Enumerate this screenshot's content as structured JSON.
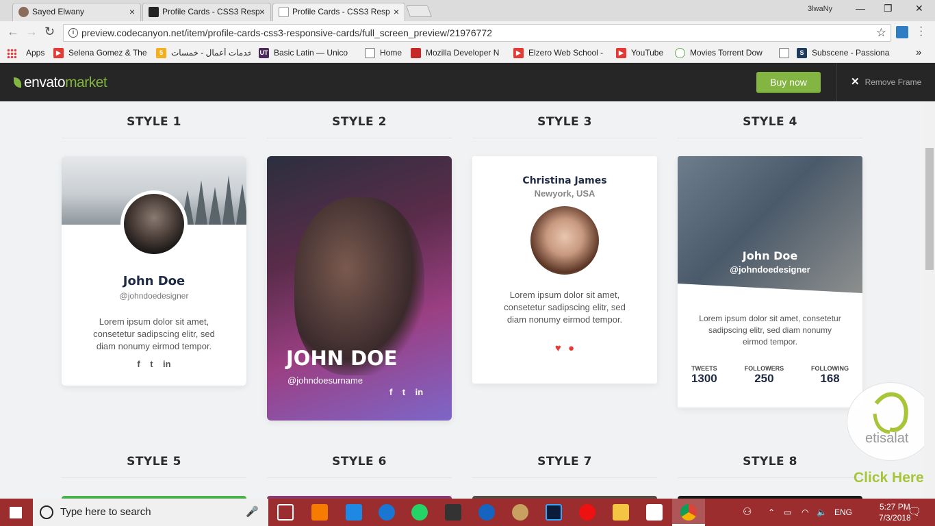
{
  "browser": {
    "tabs": [
      {
        "title": "Sayed Elwany",
        "close": "×"
      },
      {
        "title": "Profile Cards - CSS3 Resp",
        "close": "×"
      },
      {
        "title": "Profile Cards - CSS3 Resp",
        "close": "×"
      }
    ],
    "profile": "3lwaNy",
    "window_controls": {
      "minimize": "—",
      "restore": "❐",
      "close": "✕"
    },
    "url": "preview.codecanyon.net/item/profile-cards-css3-responsive-cards/full_screen_preview/21976772",
    "bookmarks": [
      {
        "label": "Apps"
      },
      {
        "label": "Selena Gomez & The",
        "color": "#e53935"
      },
      {
        "label": "خدمات أعمال - خمسات",
        "icon_text": "5",
        "color": "#f2b01e"
      },
      {
        "label": "Basic Latin — Unico",
        "icon_text": "UT",
        "color": "#4a2a5c"
      },
      {
        "label": "Home",
        "color": "#ffffff"
      },
      {
        "label": "Mozilla Developer N",
        "color": "#c62828"
      },
      {
        "label": "Elzero Web School -",
        "color": "#e53935"
      },
      {
        "label": "YouTube",
        "color": "#e53935"
      },
      {
        "label": "Movies Torrent Dow",
        "color": "#6aa84f"
      },
      {
        "label": "",
        "color": "#ffffff"
      },
      {
        "label": "Subscene - Passiona",
        "icon_text": "S",
        "color": "#1f3a5c"
      }
    ],
    "more_bookmarks": "»"
  },
  "envato": {
    "logo_envato": "envato",
    "logo_market": "market",
    "buy_now": "Buy now",
    "remove_frame": "Remove Frame",
    "remove_icon": "✕"
  },
  "styles": {
    "s1": "STYLE 1",
    "s2": "STYLE 2",
    "s3": "STYLE 3",
    "s4": "STYLE 4",
    "s5": "STYLE 5",
    "s6": "STYLE 6",
    "s7": "STYLE 7",
    "s8": "STYLE 8"
  },
  "card1": {
    "name": "John Doe",
    "handle": "@johndoedesigner",
    "bio": "Lorem ipsum dolor sit amet, consetetur sadipscing elitr, sed diam nonumy eirmod tempor.",
    "social": [
      "f",
      "t",
      "in"
    ]
  },
  "card2": {
    "name": "JOHN DOE",
    "handle": "@johndoesurname",
    "social": [
      "f",
      "t",
      "in"
    ]
  },
  "card3": {
    "name": "Christina James",
    "location": "Newyork, USA",
    "bio": "Lorem ipsum dolor sit amet, consetetur sadipscing elitr, sed diam nonumy eirmod tempor."
  },
  "card4": {
    "name": "John Doe",
    "handle": "@johndoedesigner",
    "bio": "Lorem ipsum dolor sit amet, consetetur sadipscing elitr, sed diam nonumy eirmod tempor.",
    "stats": [
      {
        "label": "TWEETS",
        "value": "1300"
      },
      {
        "label": "FOLLOWERS",
        "value": "250"
      },
      {
        "label": "FOLLOWING",
        "value": "168"
      }
    ]
  },
  "ad": {
    "brand": "etisalat",
    "cta": "Click Here"
  },
  "taskbar": {
    "search_placeholder": "Type here to search",
    "lang": "ENG",
    "time": "5:27 PM",
    "date": "7/3/2018"
  },
  "colors": {
    "accent_green": "#82b541",
    "taskbar": "#9b2d2f",
    "heart": "#e53935"
  }
}
